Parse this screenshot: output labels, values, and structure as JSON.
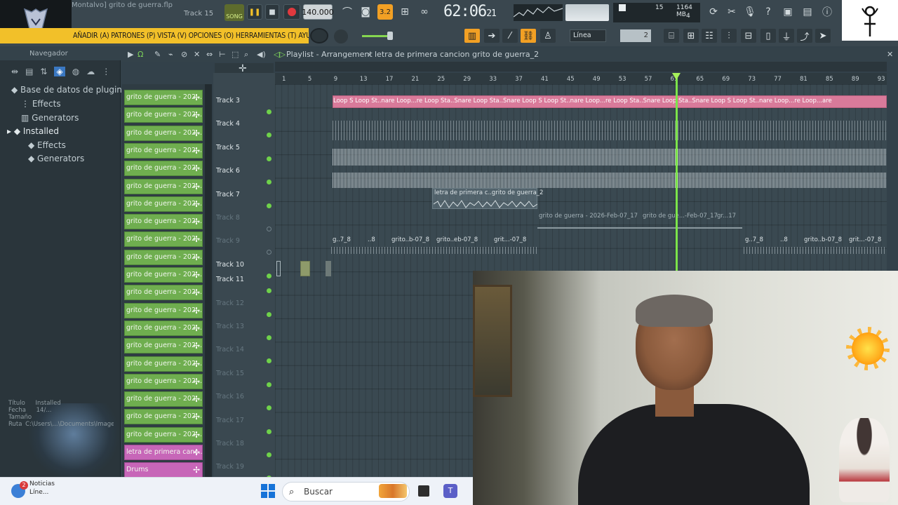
{
  "app": {
    "title": "Montalvo] grito de guerra.flp",
    "track_hint": "Track 15",
    "song_label": "SONG",
    "bpm": "140.000",
    "time": "62:06",
    "time_sub": "21",
    "pattern_num": "3.2",
    "cpu_voices": "15",
    "cpu_mem": "1164 MB",
    "cpu_sub": "4"
  },
  "menu": {
    "text": "AÑADIR (A) PATRONES (P) VISTA (V) OPCIONES (O) HERRAMIENTAS (T) AYUDA"
  },
  "toolbar": {
    "snap_mode": "Línea",
    "snap_value": "2"
  },
  "browser": {
    "header": "Navegador",
    "root": "Base de datos de plugins",
    "items": [
      {
        "label": "Effects"
      },
      {
        "label": "Generators"
      },
      {
        "label": "Installed"
      },
      {
        "label": "Effects"
      },
      {
        "label": "Generators"
      }
    ],
    "meta": [
      "Título",
      "Fecha",
      "Tamaño",
      "Ruta"
    ],
    "meta_values": [
      "Installed",
      "14/...",
      "",
      "C:\\Users\\...\\Documents\\Image-Line\\...Studio\\Presets\\...Installed"
    ]
  },
  "channels": {
    "items": [
      "grito de guerra - 202...",
      "grito de guerra - 202...",
      "grito de guerra - 202...",
      "grito de guerra - 202...",
      "grito de guerra - 202...",
      "grito de guerra - 202...",
      "grito de guerra - 202...",
      "grito de guerra - 202...",
      "grito de guerra - 202...",
      "grito de guerra - 202...",
      "grito de guerra - 202...",
      "grito de guerra - 202...",
      "grito de guerra - 202...",
      "grito de guerra - 202...",
      "grito de guerra - 202...",
      "grito de guerra - 202...",
      "grito de guerra - 202...",
      "grito de guerra - 202...",
      "grito de guerra - 202...",
      "grito de guerra - 202...",
      "letra de primera canc...",
      "Drums"
    ]
  },
  "playlist": {
    "title": "Playlist - Arrangement",
    "pattern": "letra de primera cancion grito de guerra_2",
    "ruler": [
      "1",
      "5",
      "9",
      "13",
      "17",
      "21",
      "25",
      "29",
      "33",
      "37",
      "41",
      "45",
      "49",
      "53",
      "57",
      "61",
      "65",
      "69",
      "73",
      "77",
      "81",
      "85",
      "89",
      "93"
    ],
    "tracks": [
      {
        "name": "Track 3",
        "dim": false
      },
      {
        "name": "Track 4",
        "dim": false
      },
      {
        "name": "Track 5",
        "dim": false
      },
      {
        "name": "Track 6",
        "dim": false
      },
      {
        "name": "Track 7",
        "dim": false
      },
      {
        "name": "Track 8",
        "dim": true
      },
      {
        "name": "Track 9",
        "dim": true
      },
      {
        "name": "Track 10",
        "dim": false
      },
      {
        "name": "Track 11",
        "dim": false
      },
      {
        "name": "Track 12",
        "dim": true
      },
      {
        "name": "Track 13",
        "dim": true
      },
      {
        "name": "Track 14",
        "dim": true
      },
      {
        "name": "Track 15",
        "dim": true
      },
      {
        "name": "Track 16",
        "dim": true
      },
      {
        "name": "Track 17",
        "dim": true
      },
      {
        "name": "Track 18",
        "dim": true
      },
      {
        "name": "Track 19",
        "dim": true
      }
    ],
    "track3_clip_text": "Loop S  Loop St..nare  Loop...re  Loop Sta..Snare  Loop Sta..Snare  Loop S  Loop St..nare  Loop...re  Loop Sta..Snare  Loop Sta..Snare  Loop S  Loop St..nare  Loop...re  Loop...are",
    "track7_clip": "letra de primera c..grito de guerra_2",
    "track8_clips": [
      "grito de guerra - 2026-Feb-07_17",
      "grito de gue...-Feb-07_17",
      "gr...17"
    ],
    "track9_clips_a": [
      "g..7_8",
      "..8",
      "grito..b-07_8",
      "grito..eb-07_8",
      "grit...-07_8"
    ],
    "track9_clips_b": [
      "g..7_8",
      "..8",
      "grito..b-07_8",
      "grit...-07_8"
    ]
  },
  "taskbar": {
    "news_title": "Noticias",
    "news_sub": "Líne...",
    "news_badge": "2",
    "search_placeholder": "Buscar"
  }
}
